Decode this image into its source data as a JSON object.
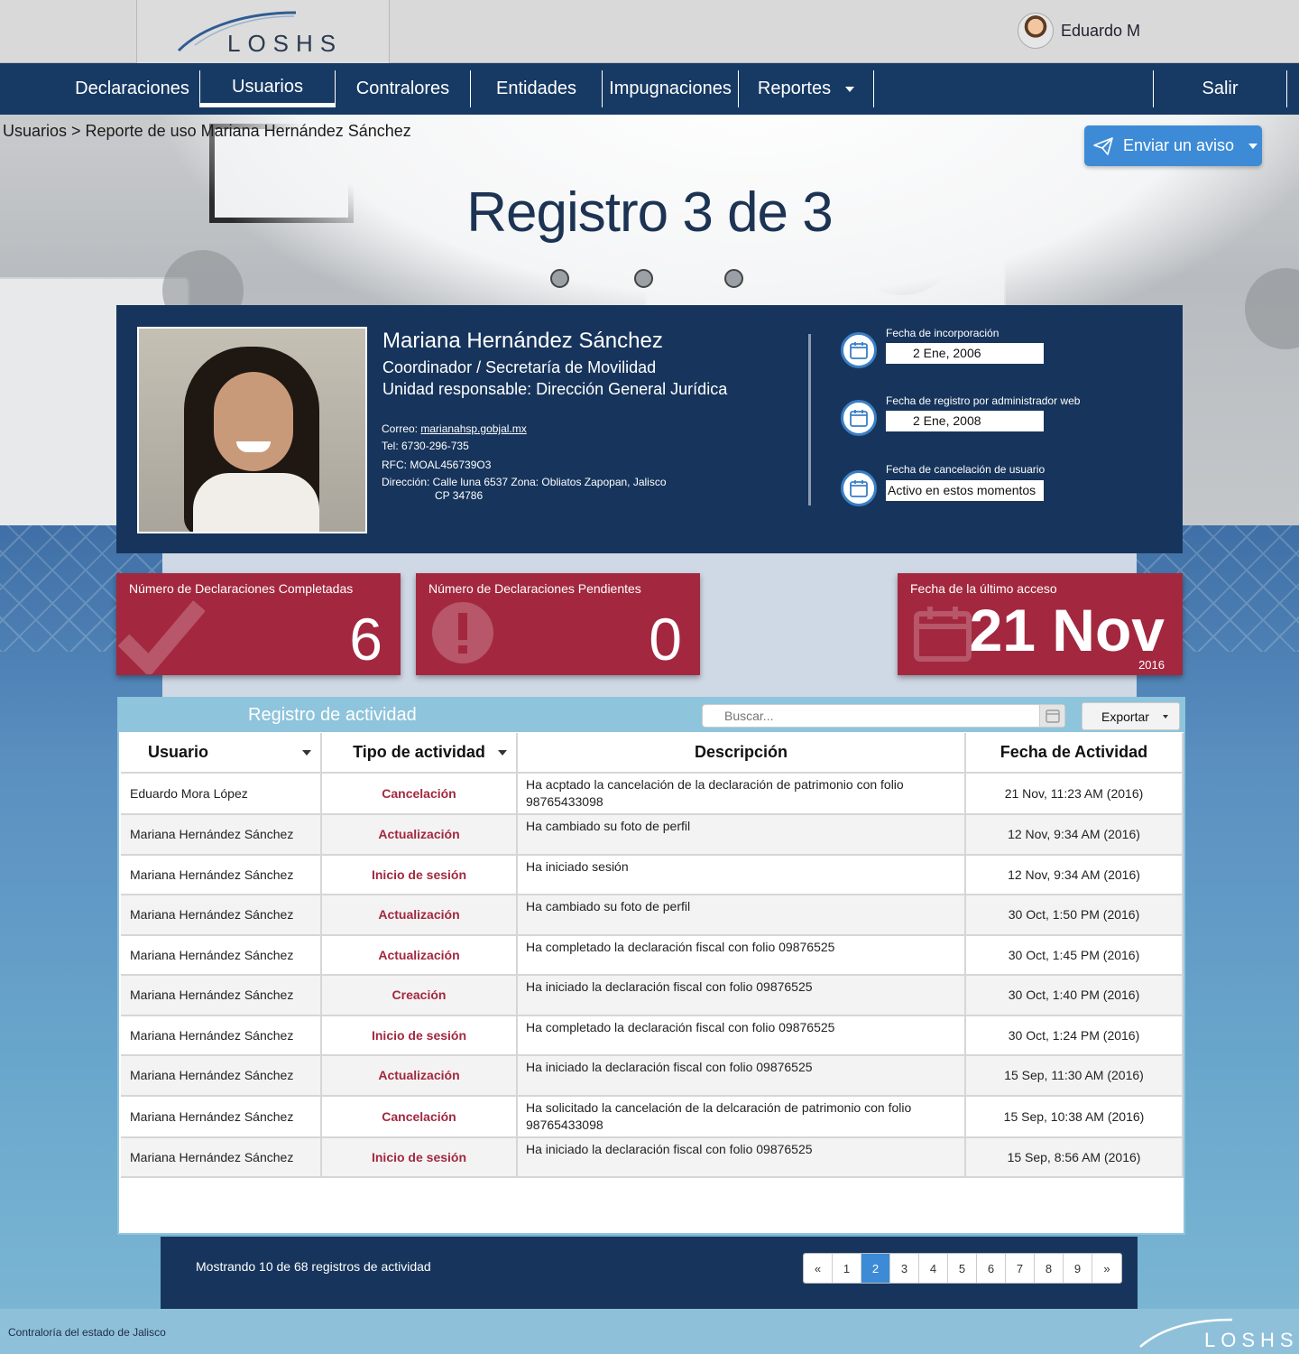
{
  "header": {
    "logo": "LOSHS",
    "user_name": "Eduardo M"
  },
  "nav": {
    "items": [
      "Declaraciones",
      "Usuarios",
      "Contralores",
      "Entidades",
      "Impugnaciones",
      "Reportes"
    ],
    "logout": "Salir"
  },
  "breadcrumb": "Usuarios > Reporte de uso Mariana Hernández Sánchez",
  "send_button": "Enviar un aviso",
  "title": "Registro 3 de 3",
  "profile": {
    "name": "Mariana Hernández Sánchez",
    "role": "Coordinador / Secretaría de Movilidad",
    "unit": "Unidad responsable: Dirección General Jurídica",
    "email_label": "Correo: ",
    "email": "marianahsp.gobjal.mx",
    "tel": "Tel: 6730-296-735",
    "rfc": "RFC: MOAL456739O3",
    "address": "Dirección: Calle luna 6537  Zona: Obliatos  Zapopan, Jalisco",
    "cp": "CP 34786",
    "dates": [
      {
        "label": "Fecha de incorporación",
        "value": "2   Ene, 2006"
      },
      {
        "label": "Fecha de registro por administrador web",
        "value": "2   Ene, 2008"
      },
      {
        "label": "Fecha de cancelación de usuario",
        "value": "Activo en estos momentos"
      }
    ]
  },
  "stats": {
    "completed_label": "Número de Declaraciones Completadas",
    "completed_value": "6",
    "pending_label": "Número de Declaraciones Pendientes",
    "pending_value": "0",
    "last_access_label": "Fecha de la último acceso",
    "last_access_value": "21 Nov",
    "last_access_year": "2016"
  },
  "activity": {
    "title": "Registro de actividad",
    "search_placeholder": "Buscar...",
    "export_label": "Exportar",
    "columns": [
      "Usuario",
      "Tipo de actividad",
      "Descripción",
      "Fecha de Actividad"
    ],
    "rows": [
      [
        "Eduardo Mora López",
        "Cancelación",
        "Ha acptado la cancelación de la declaración de patrimonio con folio 98765433098",
        "21 Nov, 11:23 AM (2016)"
      ],
      [
        "Mariana Hernández Sánchez",
        "Actualización",
        "Ha cambiado su foto de perfil",
        "12 Nov, 9:34 AM (2016)"
      ],
      [
        "Mariana Hernández Sánchez",
        "Inicio de sesión",
        "Ha iniciado sesión",
        "12 Nov, 9:34 AM (2016)"
      ],
      [
        "Mariana Hernández Sánchez",
        "Actualización",
        "Ha cambiado su foto de perfil",
        "30 Oct, 1:50 PM (2016)"
      ],
      [
        "Mariana Hernández Sánchez",
        "Actualización",
        "Ha completado la declaración fiscal con folio 09876525",
        "30 Oct, 1:45 PM (2016)"
      ],
      [
        "Mariana Hernández Sánchez",
        "Creación",
        "Ha iniciado la declaración fiscal con folio 09876525",
        "30 Oct, 1:40 PM (2016)"
      ],
      [
        "Mariana Hernández Sánchez",
        "Inicio de sesión",
        "Ha completado la declaración fiscal con folio 09876525",
        "30 Oct, 1:24 PM (2016)"
      ],
      [
        "Mariana Hernández Sánchez",
        "Actualización",
        "Ha iniciado la declaración fiscal con folio 09876525",
        "15 Sep, 11:30 AM (2016)"
      ],
      [
        "Mariana Hernández Sánchez",
        "Cancelación",
        "Ha solicitado la cancelación de la delcaración de patrimonio con folio 98765433098",
        "15 Sep, 10:38 AM (2016)"
      ],
      [
        "Mariana Hernández Sánchez",
        "Inicio de sesión",
        "Ha iniciado la declaración fiscal con folio 09876525",
        "15 Sep, 8:56 AM (2016)"
      ]
    ]
  },
  "pager": {
    "summary": "Mostrando 10 de 68 registros de actividad",
    "prev": "«",
    "pages": [
      "1",
      "2",
      "3",
      "4",
      "5",
      "6",
      "7",
      "8",
      "9"
    ],
    "next": "»",
    "active_page": "2"
  },
  "footer": {
    "text": "Contraloría del estado de Jalisco",
    "logo": "LOSHS"
  },
  "colors": {
    "navy": "#173a64",
    "accent_blue": "#3d8bd6",
    "stat_red": "#a3283f",
    "table_head": "#8ec4dc"
  }
}
